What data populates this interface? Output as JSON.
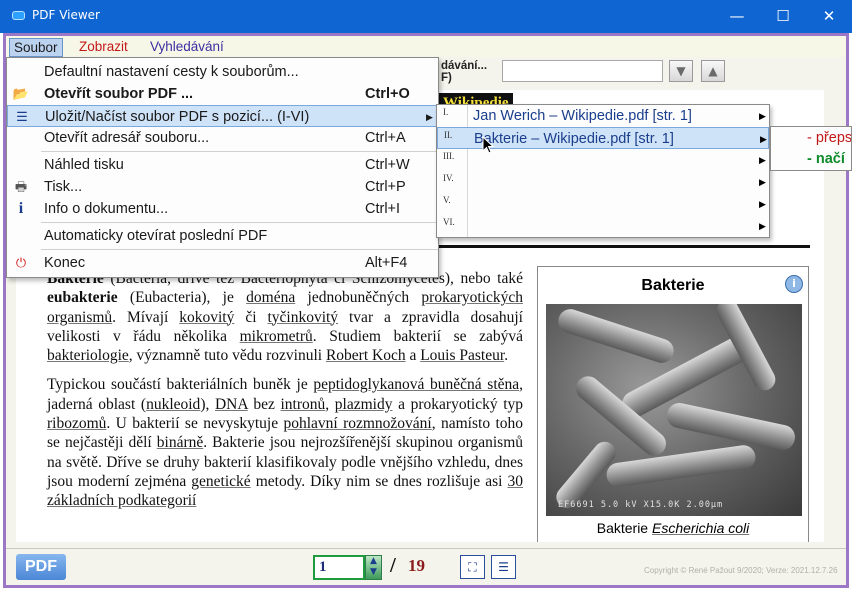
{
  "window": {
    "title": "PDF Viewer",
    "minimize": "—",
    "maximize": "☐",
    "close": "✕"
  },
  "menubar": {
    "soubor": "Soubor",
    "zobrazit": "Zobrazit",
    "vyhledavani": "Vyhledávání"
  },
  "toolbar": {
    "search_label_line1": "dávání...",
    "search_label_line2": "F)",
    "search_value": "",
    "down_arrow": "▼",
    "up_arrow": "▲"
  },
  "document": {
    "header_fragment": "Wikipedie",
    "paragraph1": {
      "t1": "Bakterie",
      "t2": " (Bacteria, dříve též Bacteriophyta či Schizomycetes), nebo také ",
      "t3": "eubakterie",
      "t4": " (Eubacteria), je ",
      "t5": "doména",
      "t6": " jednobuněčných ",
      "t7": "prokaryotických",
      "t8": " ",
      "t9": "organismů",
      "t10": ". Mívají ",
      "t11": "kokovitý",
      "t12": " či ",
      "t13": "tyčinkovitý",
      "t14": " tvar a zpravidla dosahují velikosti v řádu několika ",
      "t15": "mikrometrů",
      "t16": ". Studiem bakterií se zabývá ",
      "t17": "bakteriologie",
      "t18": ", významně tuto vědu rozvinuli ",
      "t19": "Robert Koch",
      "t20": " a ",
      "t21": "Louis Pasteur",
      "t22": "."
    },
    "paragraph2": {
      "t1": "Typickou součástí bakteriálních buněk je ",
      "t2": "peptidoglykanová buněčná stěna",
      "t3": ", jaderná oblast (",
      "t4": "nukleoid",
      "t5": "), ",
      "t6": "DNA",
      "t7": " bez ",
      "t8": "intronů",
      "t9": ", ",
      "t10": "plazmidy",
      "t11": " a prokaryotický typ ",
      "t12": "ribozomů",
      "t13": ". U bakterií se nevyskytuje ",
      "t14": "pohlavní rozmnožování",
      "t15": ", namísto toho se nejčastěji dělí ",
      "t16": "binárně",
      "t17": ". Bakterie jsou nejrozšířenější skupinou organismů na světě. Dříve se druhy bakterií klasifikovaly podle vnějšího vzhledu, dnes jsou moderní zejména ",
      "t18": "genetické",
      "t19": " metody. Díky nim se dnes rozlišuje asi ",
      "t20": "30 základních podkategorií"
    },
    "infobox": {
      "title": "Bakterie",
      "info_icon": "i",
      "scale_text": "EF6691  5.0 kV  X15.0K  2.00µm",
      "caption_prefix": "Bakterie ",
      "caption_italic": "Escherichia coli"
    }
  },
  "soubor_menu": {
    "items": [
      {
        "icon": "",
        "label": "Defaultní nastavení cesty k souborům...",
        "shortcut": ""
      },
      {
        "icon": "📂",
        "label": "Otevřít soubor PDF ...",
        "shortcut": "Ctrl+O"
      },
      {
        "icon": "☰",
        "label": "Uložit/Načíst soubor PDF s pozicí... (I-VI)",
        "shortcut": "",
        "arrow": "▶"
      },
      {
        "icon": "",
        "label": "Otevřít adresář souboru...",
        "shortcut": "Ctrl+A"
      },
      {
        "icon": "",
        "label": "Náhled tisku",
        "shortcut": "Ctrl+W"
      },
      {
        "icon": "🖶",
        "label": "Tisk...",
        "shortcut": "Ctrl+P"
      },
      {
        "icon": "i",
        "label": "Info o dokumentu...",
        "shortcut": "Ctrl+I"
      },
      {
        "icon": "",
        "label": "Automaticky otevírat poslední PDF",
        "shortcut": ""
      },
      {
        "icon": "⏻",
        "label": "Konec",
        "shortcut": "Alt+F4"
      }
    ]
  },
  "slots_submenu": {
    "items": [
      {
        "num": "I.",
        "label": "Jan Werich – Wikipedie.pdf  [str. 1]",
        "arrow": "▶"
      },
      {
        "num": "II.",
        "label": "Bakterie – Wikipedie.pdf  [str. 1]",
        "arrow": "▶"
      },
      {
        "num": "III.",
        "label": "",
        "arrow": "▶"
      },
      {
        "num": "IV.",
        "label": "",
        "arrow": "▶"
      },
      {
        "num": "V.",
        "label": "",
        "arrow": "▶"
      },
      {
        "num": "VI.",
        "label": "",
        "arrow": "▶"
      }
    ]
  },
  "slot_action_submenu": {
    "overwrite": "- přeps",
    "load": "- načí"
  },
  "statusbar": {
    "logo": "PDF",
    "page_current": "1",
    "page_sep": "/",
    "page_total": "19",
    "copyright": "Copyright © René Pažout 9/2020;  Verze: 2021.12.7.26"
  }
}
